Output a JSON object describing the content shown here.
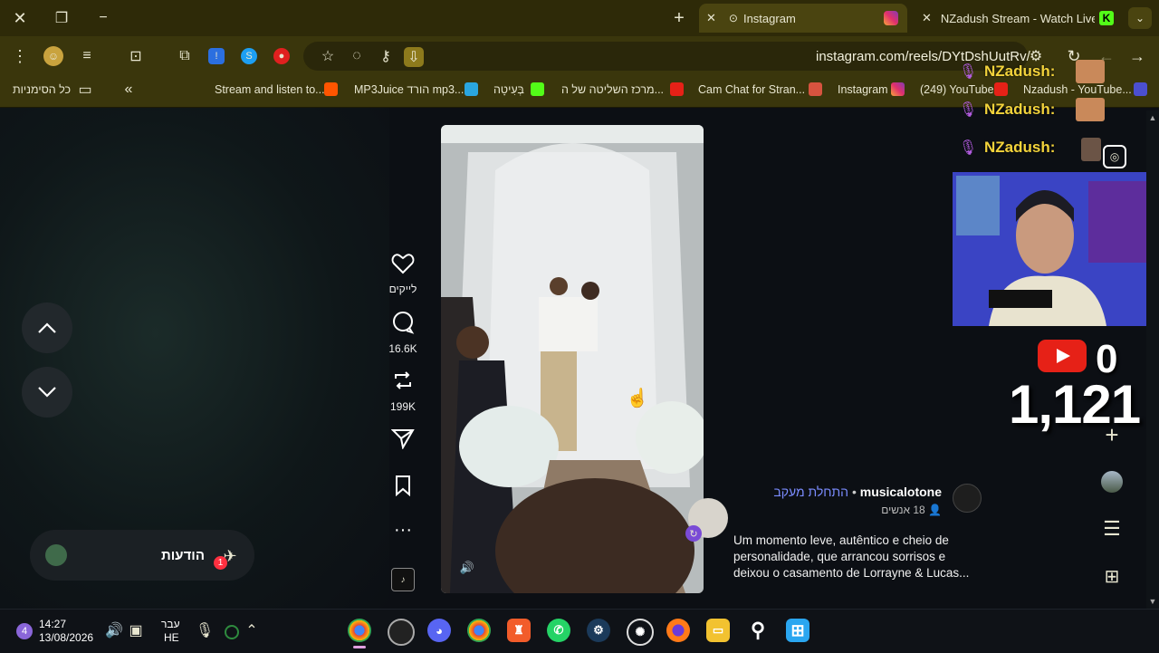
{
  "tabs": [
    {
      "label": "Instagram",
      "active": true
    },
    {
      "label": "NZadush Stream - Watch Live o",
      "active": false
    }
  ],
  "address": {
    "url": "instagram.com/reels/DYtDshUutRv/"
  },
  "bookmarks": {
    "all_label": "כל הסימניות",
    "items": [
      "Stream and listen to...",
      "MP3Juice הורד mp3...",
      "בְּעִיטָה",
      "מרכז השליטה של ה...",
      "Cam Chat for Stran...",
      "Instagram",
      "(249) YouTube",
      "Nzadush - YouTube..."
    ]
  },
  "reel": {
    "likes_label": "לייקים",
    "comments_count": "16.6K",
    "reposts_count": "199K",
    "author": "musicalotone",
    "follow_label": "התחלת מעקב",
    "people": "18 אנשים",
    "caption_lines": [
      "Um momento leve, autêntico e cheio de",
      "personalidade, que arrancou sorrisos e",
      "deixou o casamento de Lorrayne & Lucas..."
    ]
  },
  "notifications": {
    "label": "הודעות",
    "badge": "1"
  },
  "overlay": {
    "chat_names": [
      "NZadush:",
      "NZadush:",
      "NZadush:"
    ],
    "youtube_count_small": "0",
    "youtube_count_big": "1,121"
  },
  "taskbar": {
    "time": "14:27",
    "date": "13/08/2026",
    "lang_top": "עבר",
    "lang_bottom": "HE",
    "widget_badge": "4"
  },
  "colors": {
    "accent_yellow": "#f3d33b",
    "browser_bar": "#3a360c",
    "youtube_red": "#e62117"
  }
}
